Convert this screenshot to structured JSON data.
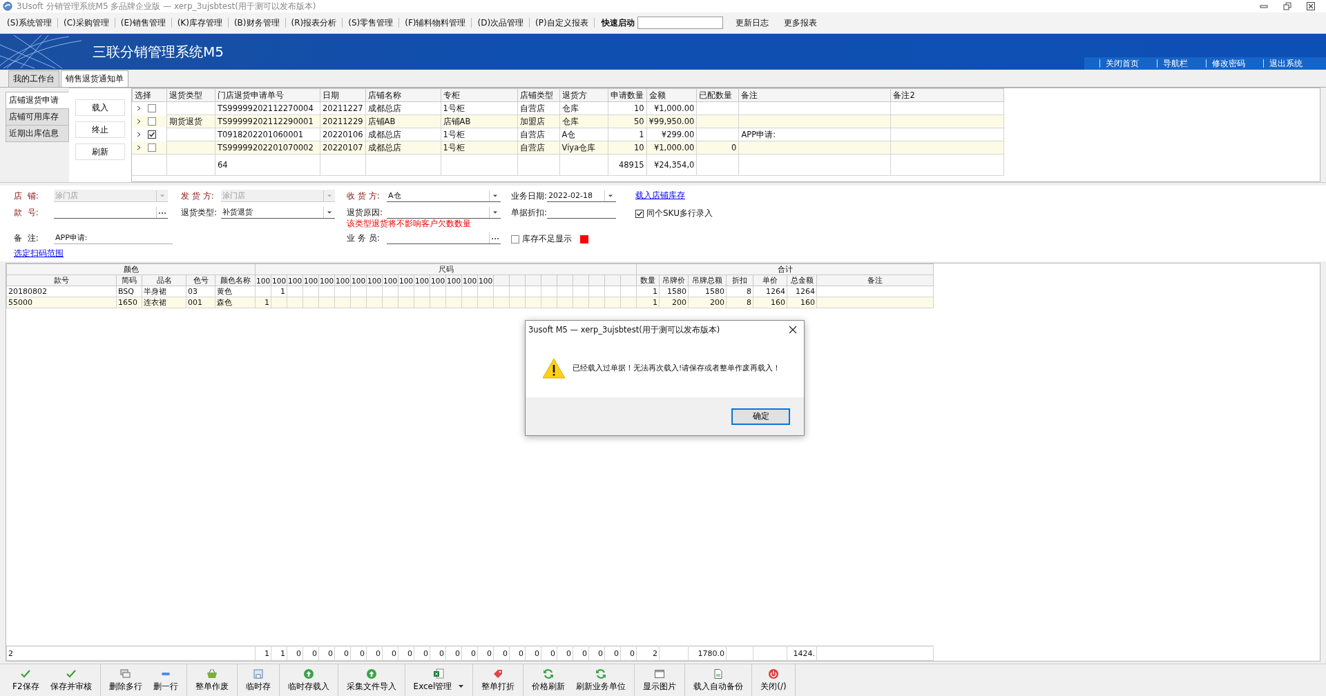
{
  "window": {
    "title": "3Usoft 分销管理系统M5 多品牌企业版 — xerp_3ujsbtest(用于测可以发布版本)"
  },
  "menu": [
    "(S)系统管理",
    "(C)采购管理",
    "(E)销售管理",
    "(K)库存管理",
    "(B)财务管理",
    "(R)报表分析",
    "(S)零售管理",
    "(F)辅料物料管理",
    "(D)次品管理",
    "(P)自定义报表"
  ],
  "quick_launch": {
    "label": "快速启动"
  },
  "menu_links": [
    "更新日志",
    "更多报表"
  ],
  "banner": {
    "title": "三联分销管理系统M5",
    "links": [
      "关闭首页",
      "导航栏",
      "修改密码",
      "退出系统"
    ]
  },
  "page_tabs": [
    {
      "label": "我的工作台",
      "selected": false
    },
    {
      "label": "销售退货通知单",
      "selected": true
    }
  ],
  "side_tabs": [
    {
      "label": "店铺退货申请",
      "selected": true
    },
    {
      "label": "店铺可用库存",
      "selected": false
    },
    {
      "label": "近期出库信息",
      "selected": false
    }
  ],
  "side_buttons": [
    "载入",
    "终止",
    "刷新"
  ],
  "requests": {
    "columns": [
      "选择",
      "退货类型",
      "门店退货申请单号",
      "日期",
      "店铺名称",
      "专柜",
      "店铺类型",
      "退货方",
      "申请数量",
      "金额",
      "已配数量",
      "备注",
      "备注2"
    ],
    "rows": [
      {
        "checked": false,
        "request_no": "TS99999202112270004",
        "date": "20211227",
        "store": "成都总店",
        "counter": "1号柜",
        "store_type": "自营店",
        "returner": "仓库",
        "qty": "10",
        "amount": "¥1,000.00"
      },
      {
        "checked": false,
        "return_type": "期货退货",
        "request_no": "TS99999202112290001",
        "date": "20211229",
        "store": "店铺AB",
        "counter": "店铺AB",
        "store_type": "加盟店",
        "returner": "仓库",
        "qty": "50",
        "amount": "¥99,950.00"
      },
      {
        "checked": true,
        "request_no": "T0918202201060001",
        "date": "20220106",
        "store": "成都总店",
        "counter": "1号柜",
        "store_type": "自营店",
        "returner": "A仓",
        "qty": "1",
        "amount": "¥299.00",
        "note": "APP申请:"
      },
      {
        "checked": false,
        "request_no": "TS99999202201070002",
        "date": "20220107",
        "store": "成都总店",
        "counter": "1号柜",
        "store_type": "自营店",
        "returner": "Viya仓库",
        "qty": "10",
        "amount": "¥1,000.00",
        "allocated": "0"
      }
    ],
    "summary": {
      "request_no": "64",
      "qty": "48915",
      "amount": "¥24,354,0"
    }
  },
  "form": {
    "rows": [
      [
        {
          "kind": "select",
          "label": "店  铺:",
          "value": "涂门店",
          "required": true,
          "disabled": true
        },
        {
          "kind": "select",
          "label": "发 货 方:",
          "value": "涂门店",
          "required": true,
          "disabled": true
        },
        {
          "kind": "select",
          "label": "收 货 方:",
          "value": "A仓",
          "required": true,
          "disabled": false
        },
        {
          "kind": "date",
          "label": "业务日期:",
          "value": "2022-02-18",
          "required": false,
          "disabled": false
        },
        {
          "kind": "link",
          "label": "载入店铺库存"
        }
      ],
      [
        {
          "kind": "lookup",
          "label": "款  号:",
          "required": true,
          "disabled": false
        },
        {
          "kind": "select",
          "label": "退货类型:",
          "value": "补货退货",
          "required": false,
          "disabled": false
        },
        {
          "kind": "select",
          "label": "退货原因:",
          "hint": "该类型退货将不影响客户欠数数量",
          "required": false,
          "disabled": false
        },
        {
          "kind": "text",
          "label": "单据折扣:",
          "required": false,
          "disabled": false
        },
        {
          "kind": "checkbox",
          "label": "同个SKU多行录入",
          "checked": true
        }
      ],
      [
        {
          "kind": "note",
          "label": "备  注:",
          "value": "APP申请:",
          "required": false,
          "disabled": false
        },
        "",
        {
          "kind": "lookup",
          "label": "业 务 员:",
          "required": false,
          "disabled": false
        },
        {
          "kind": "checkbox",
          "label": "库存不足显示",
          "checked": false,
          "color": "#ff0000"
        }
      ]
    ],
    "link": "选定扫码范围"
  },
  "items": {
    "groups": [
      "颜色",
      "尺码",
      "合计"
    ],
    "color_columns": [
      "款号",
      "简码",
      "品名",
      "色号",
      "颜色名称"
    ],
    "size_columns": [
      "100",
      "100",
      "100",
      "100",
      "100",
      "100",
      "100",
      "100",
      "100",
      "100",
      "100",
      "100",
      "100",
      "100",
      "100"
    ],
    "total_columns": [
      "数量",
      "吊牌价",
      "吊牌总额",
      "折扣",
      "单价",
      "总金额",
      "备注"
    ],
    "rows": [
      {
        "cells": [
          "20180802",
          "BSQ",
          "半身裙",
          "03",
          "黄色"
        ],
        "sizes": {
          "2": "1"
        },
        "totals": [
          "1",
          "1580",
          "1580",
          "8",
          "1264",
          "1264"
        ]
      },
      {
        "cells": [
          "55000",
          "1650",
          "连衣裙",
          "001",
          "森色"
        ],
        "sizes": {
          "1": "1"
        },
        "totals": [
          "1",
          "200",
          "200",
          "8",
          "160",
          "160"
        ]
      }
    ],
    "footer": {
      "count": "2",
      "sizes": [
        "1",
        "1",
        "0",
        "0",
        "0",
        "0",
        "0",
        "0",
        "0",
        "0",
        "0",
        "0",
        "0",
        "0",
        "0",
        "0",
        "0",
        "0",
        "0",
        "0",
        "0",
        "0",
        "0",
        "0"
      ],
      "totals": {
        "qty": "2",
        "tag_total": "1780.0",
        "amount": "1424."
      }
    }
  },
  "dialog": {
    "title": "3usoft M5 — xerp_3ujsbtest(用于测可以发布版本)",
    "message": "已经载入过单据！无法再次载入!请保存或者整单作废再载入！",
    "button": "确定"
  },
  "toolbar": [
    [
      {
        "label": "F2保存"
      },
      {
        "label": "保存并审核"
      }
    ],
    [
      {
        "label": "删除多行"
      },
      {
        "label": "删一行"
      }
    ],
    [
      {
        "label": "整单作废"
      }
    ],
    [
      {
        "label": "临时存"
      }
    ],
    [
      {
        "label": "临时存载入"
      }
    ],
    [
      {
        "label": "采集文件导入"
      }
    ],
    [
      {
        "label": "Excel管理",
        "has_menu": true
      }
    ],
    [
      {
        "label": "整单打折"
      }
    ],
    [
      {
        "label": "价格刷新"
      },
      {
        "label": "刷新业务单位"
      }
    ],
    [
      {
        "label": "显示图片"
      }
    ],
    [
      {
        "label": "载入自动备份"
      }
    ],
    [
      {
        "label": "关闭(/)"
      }
    ]
  ]
}
